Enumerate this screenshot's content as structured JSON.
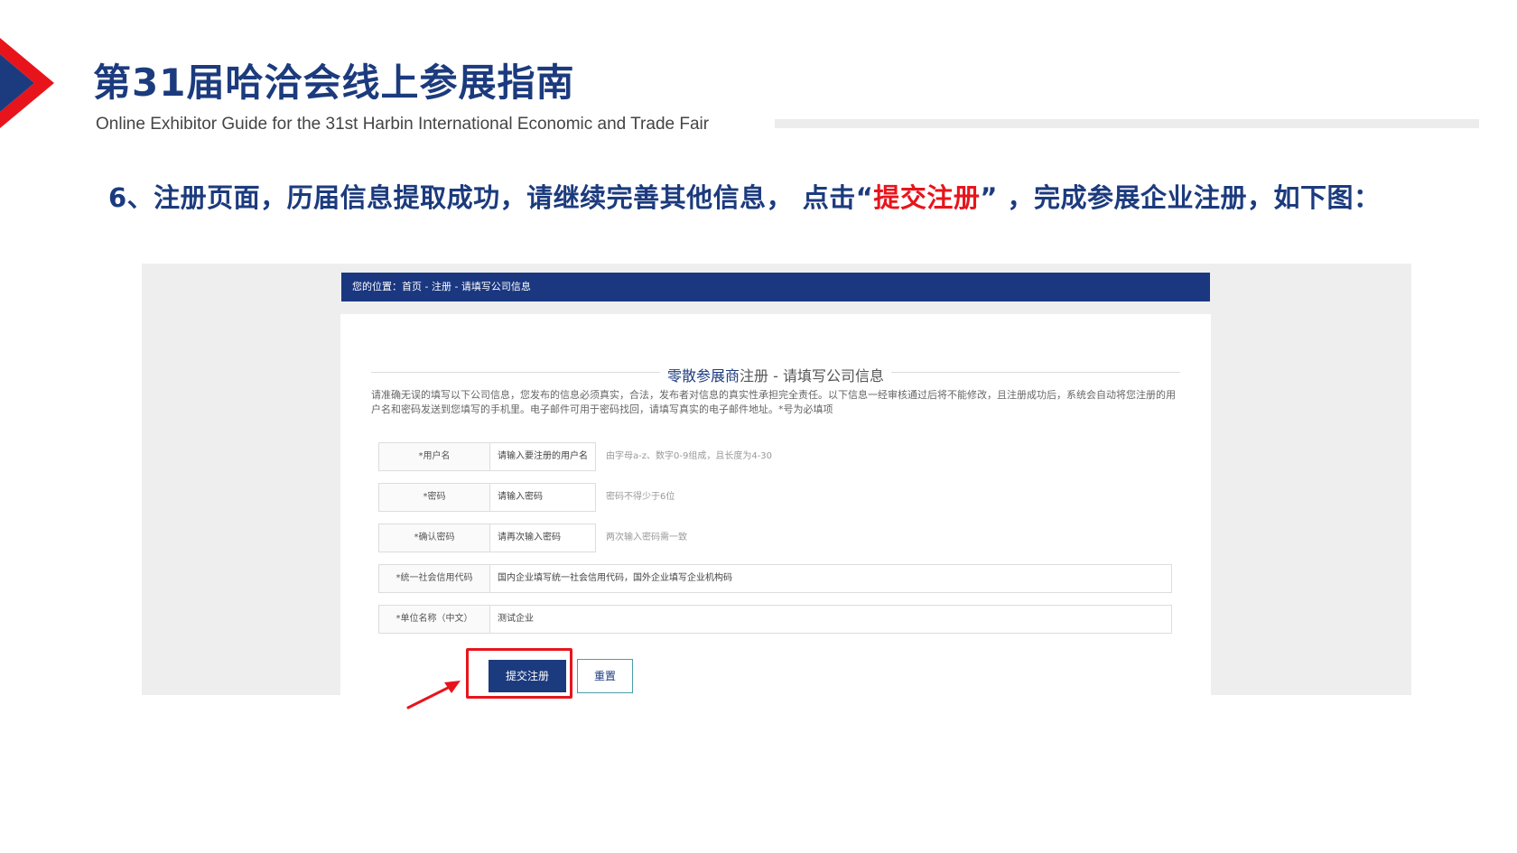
{
  "slide": {
    "title": "第31届哈洽会线上参展指南",
    "subtitle": "Online Exhibitor Guide for the 31st Harbin International Economic and Trade Fair",
    "step_before": "6、注册页面，历届信息提取成功，请继续完善其他信息， 点击“",
    "step_highlight": "提交注册",
    "step_after": "” ，完成参展企业注册，如下图：",
    "colors": {
      "brand_blue": "#1c3b7e",
      "highlight_red": "#e8141c"
    }
  },
  "screenshot": {
    "breadcrumb": "您的位置：首页 - 注册 - 请填写公司信息",
    "form_title_blue": "零散参展商",
    "form_title_rest": "注册 - 请填写公司信息",
    "notice": "请准确无误的填写以下公司信息，您发布的信息必须真实，合法，发布者对信息的真实性承担完全责任。以下信息一经审核通过后将不能修改，且注册成功后，系统会自动将您注册的用户名和密码发送到您填写的手机里。电子邮件可用于密码找回，请填写真实的电子邮件地址。*号为必填项",
    "fields": [
      {
        "label": "*用户名",
        "value": "请输入要注册的用户名",
        "hint": "由字母a-z、数字0-9组成，且长度为4-30"
      },
      {
        "label": "*密码",
        "value": "请输入密码",
        "hint": "密码不得少于6位"
      },
      {
        "label": "*确认密码",
        "value": "请再次输入密码",
        "hint": "两次输入密码需一致"
      },
      {
        "label": "*统一社会信用代码",
        "value": "国内企业填写统一社会信用代码，国外企业填写企业机构码"
      },
      {
        "label": "*单位名称（中文）",
        "value": "测试企业"
      }
    ],
    "submit_label": "提交注册",
    "reset_label": "重置"
  }
}
